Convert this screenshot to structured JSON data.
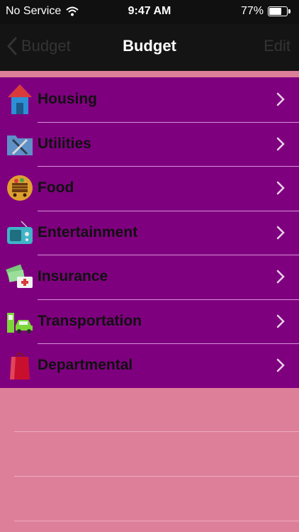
{
  "status_bar": {
    "carrier": "No Service",
    "time": "9:47 AM",
    "battery_percent": "77%",
    "battery_level": 0.77
  },
  "nav": {
    "back_label": "Budget",
    "title": "Budget",
    "edit_label": "Edit"
  },
  "categories": [
    {
      "label": "Housing",
      "icon": "house-icon"
    },
    {
      "label": "Utilities",
      "icon": "tools-folder-icon"
    },
    {
      "label": "Food",
      "icon": "shopping-cart-icon"
    },
    {
      "label": "Entertainment",
      "icon": "radio-icon"
    },
    {
      "label": "Insurance",
      "icon": "money-medical-icon"
    },
    {
      "label": "Transportation",
      "icon": "car-fuel-icon"
    },
    {
      "label": "Departmental",
      "icon": "shopping-bag-icon"
    }
  ],
  "colors": {
    "list_background": "#7f007f",
    "page_background": "#de7f9a",
    "nav_background": "#141414"
  }
}
